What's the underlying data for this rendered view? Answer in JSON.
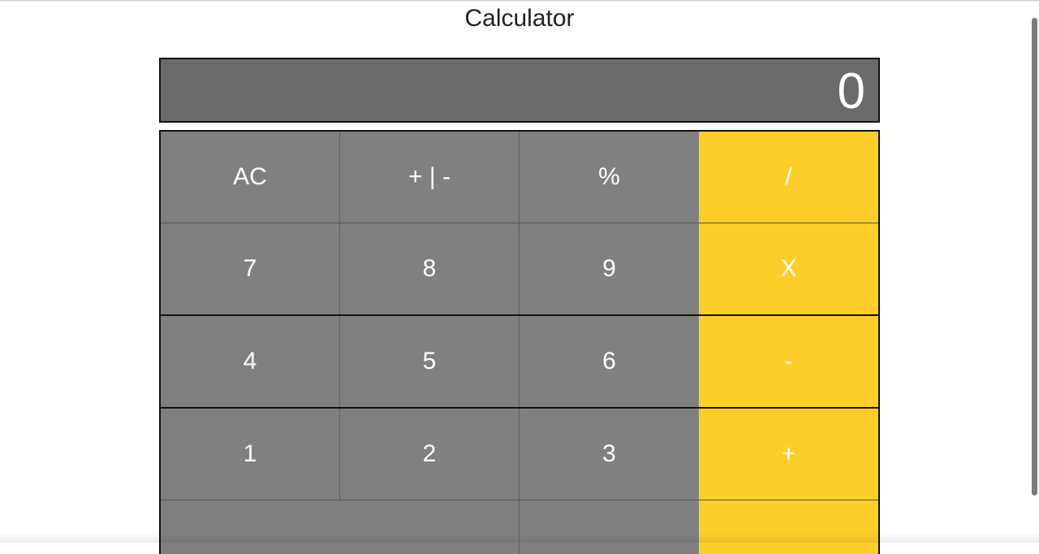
{
  "app": {
    "title": "Calculator"
  },
  "display": {
    "value": "0"
  },
  "keys": {
    "ac": "AC",
    "plus_minus": "+ | -",
    "percent": "%",
    "divide": "/",
    "seven": "7",
    "eight": "8",
    "nine": "9",
    "multiply": "X",
    "four": "4",
    "five": "5",
    "six": "6",
    "subtract": "-",
    "one": "1",
    "two": "2",
    "three": "3",
    "add": "+",
    "zero": "",
    "decimal": "",
    "equals": ""
  },
  "colors": {
    "display_bg": "#6b6b6b",
    "number_key": "#808080",
    "operator_key": "#fdce2a",
    "border": "#111111"
  }
}
